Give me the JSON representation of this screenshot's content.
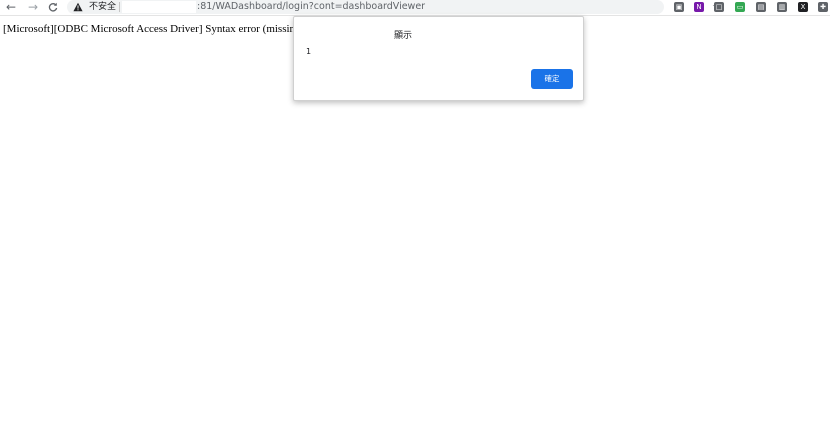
{
  "browser": {
    "security_label": "不安全",
    "url_text": ":81/WADashboard/login?cont=dashboardViewer",
    "nav": {
      "back_glyph": "←",
      "forward_glyph": "→",
      "reload_glyph": "C"
    },
    "bookmark_glyph": "☆",
    "extensions": [
      {
        "name": "extension-1-icon",
        "glyph": "▣",
        "color": "#5f6368"
      },
      {
        "name": "onenote-icon",
        "glyph": "N",
        "color": "#7719aa"
      },
      {
        "name": "extension-3-icon",
        "glyph": "□",
        "color": "#5f6368"
      },
      {
        "name": "extension-4-icon",
        "glyph": "▭",
        "color": "#34a853"
      },
      {
        "name": "extension-5-icon",
        "glyph": "▤",
        "color": "#5f6368"
      },
      {
        "name": "extension-6-icon",
        "glyph": "▥",
        "color": "#5f6368"
      },
      {
        "name": "extension-7-icon",
        "glyph": "X",
        "color": "#202124"
      },
      {
        "name": "puzzle-icon",
        "glyph": "✚",
        "color": "#5f6368"
      }
    ]
  },
  "page": {
    "error_text": "[Microsoft][ODBC Microsoft Access Driver] Syntax error (missing operator) in query expression"
  },
  "dialog": {
    "title": "顯示",
    "message": "1",
    "ok_label": "確定"
  }
}
